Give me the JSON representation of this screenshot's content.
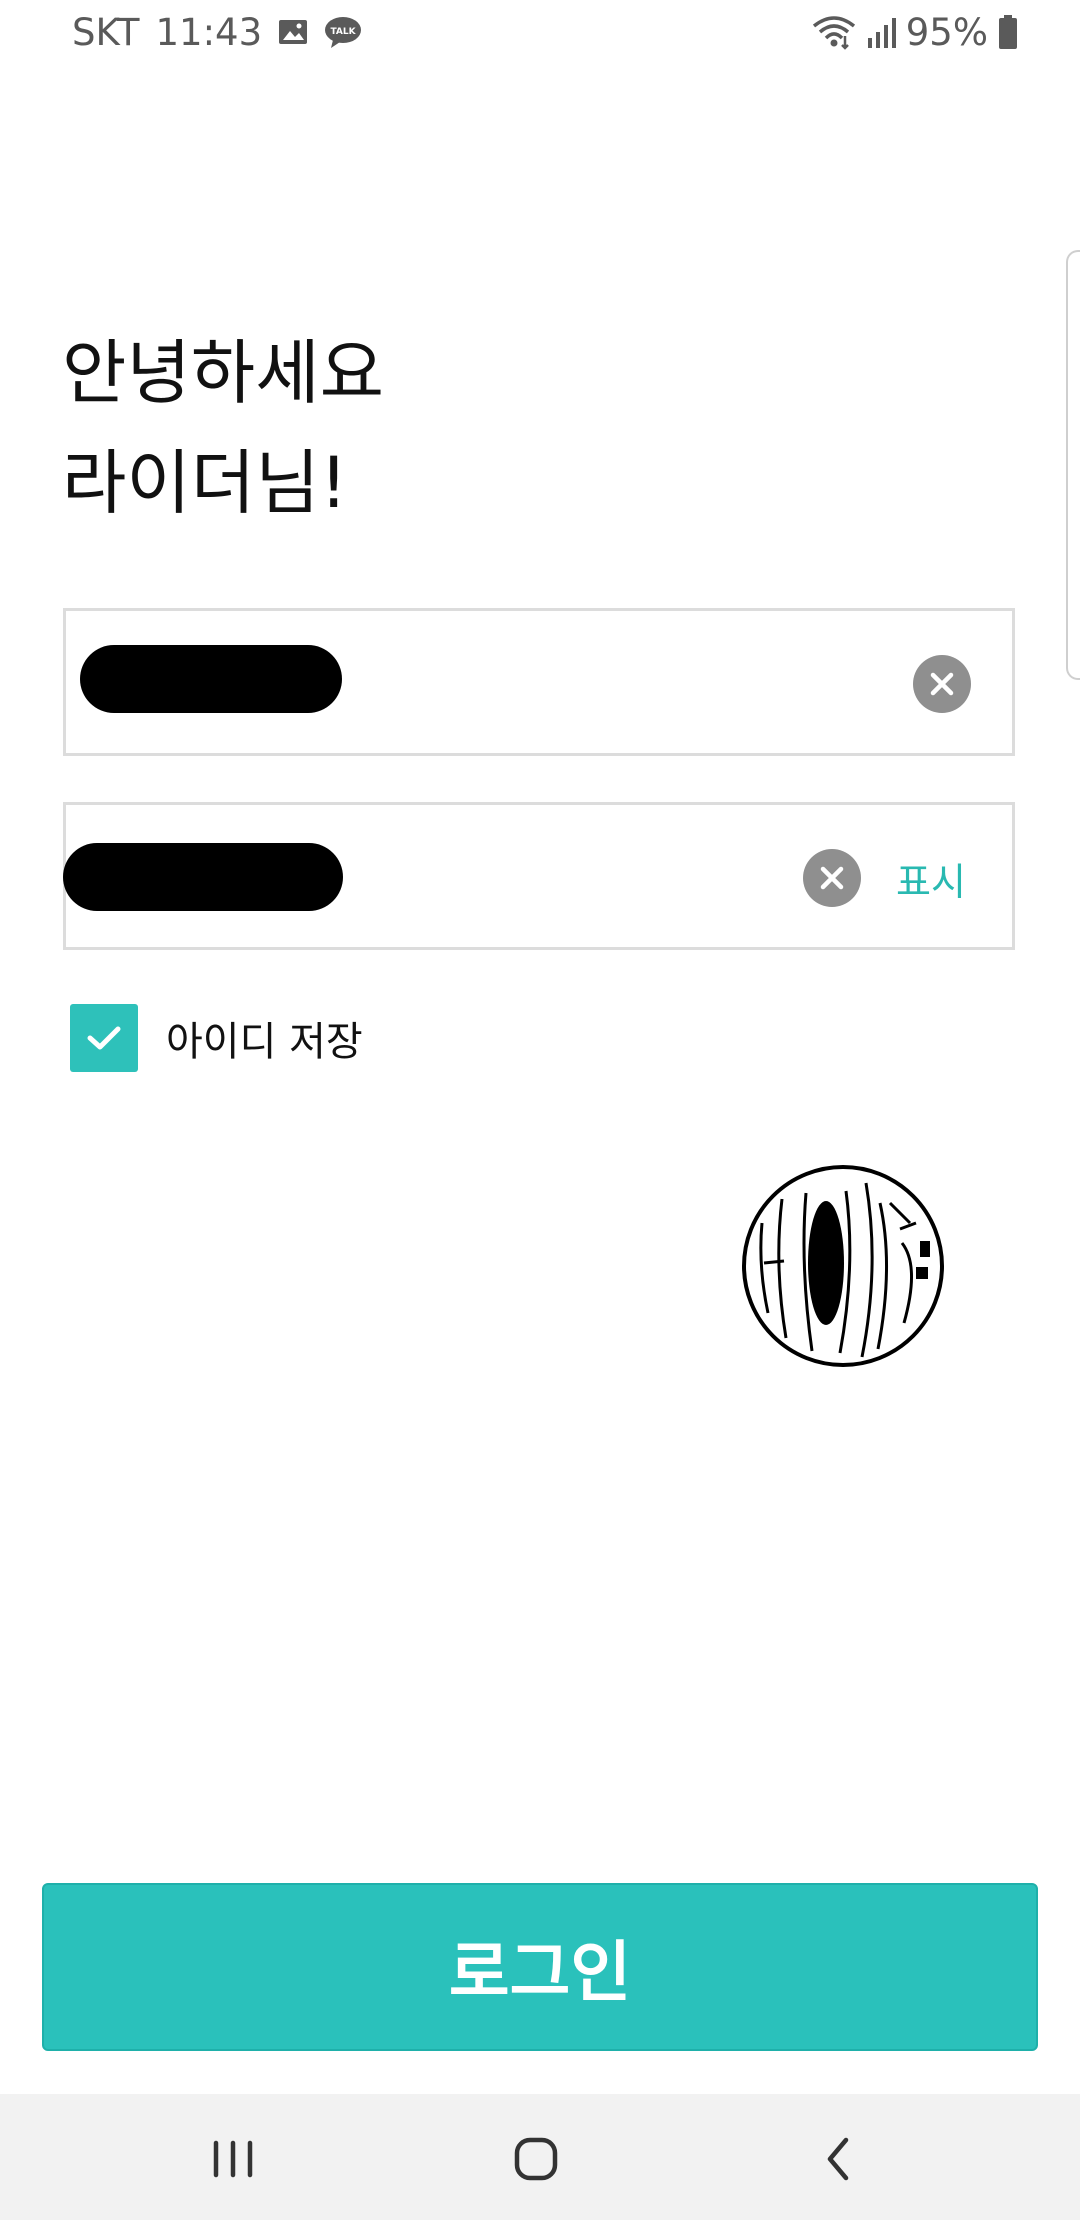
{
  "status_bar": {
    "carrier": "SKT",
    "time": "11:43",
    "battery": "95%",
    "left_icons": [
      "gallery-icon",
      "talk-icon"
    ],
    "right_icons": [
      "wifi-icon",
      "signal-icon",
      "battery-icon"
    ],
    "talk_badge": "TALK"
  },
  "greeting": {
    "line1": "안녕하세요",
    "line2": "라이더님!"
  },
  "login_form": {
    "id_field": {
      "value": "",
      "redacted": true
    },
    "password_field": {
      "value": "",
      "redacted": true,
      "show_label": "표시"
    },
    "save_id": {
      "label": "아이디 저장",
      "checked": true
    }
  },
  "login_button": {
    "label": "로그인"
  },
  "colors": {
    "accent": "#2ac1bb",
    "show_text": "#29b9b1",
    "clear_icon_bg": "#8f8f8f",
    "field_border": "#dcdcdc",
    "nav_bg": "#f2f2f2"
  },
  "nav_bar": {
    "buttons": [
      "recents-icon",
      "home-icon",
      "back-icon"
    ]
  }
}
